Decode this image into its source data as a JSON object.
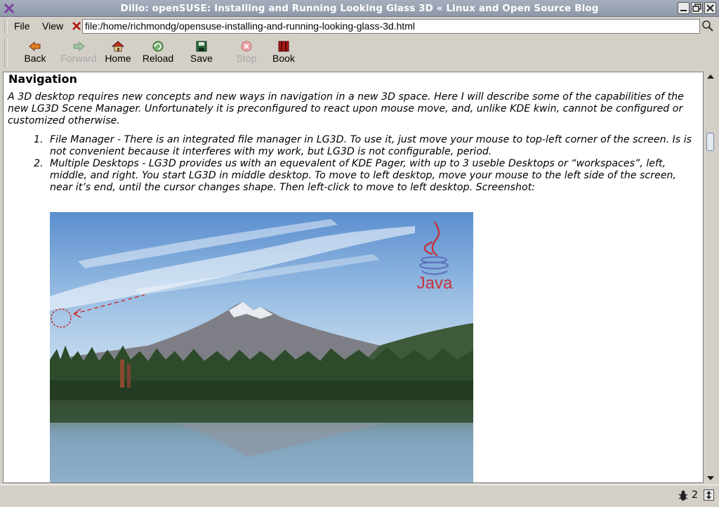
{
  "window": {
    "title": "Dillo: openSUSE: Installing and Running Looking Glass 3D « Linux and Open Source Blog"
  },
  "menu": {
    "file_label": "File",
    "view_label": "View"
  },
  "location": {
    "url": "file:/home/richmondg/opensuse-installing-and-running-looking-glass-3d.html"
  },
  "toolbar": {
    "back_label": "Back",
    "forward_label": "Forward",
    "home_label": "Home",
    "reload_label": "Reload",
    "save_label": "Save",
    "stop_label": "Stop",
    "book_label": "Book"
  },
  "content": {
    "heading": "Navigation",
    "intro": "A 3D desktop requires new concepts and new ways in navigation in a new 3D space. Here I will describe some of the capabilities of the new LG3D Scene Manager. Unfortunately it is preconfigured to react upon mouse move, and, unlike KDE kwin, cannot be configured or customized otherwise.",
    "list": [
      {
        "number": "1.",
        "text": "File Manager - There is an integrated file manager in LG3D. To use it, just move your mouse to top-left corner of the screen. Is is not convenient because it interferes with my work, but LG3D is not configurable, period."
      },
      {
        "number": "2.",
        "text": "Multiple Desktops - LG3D provides us with an equevalent of KDE Pager, with up to 3 useble Desktops or “workspaces”, left, middle, and right. You start LG3D in middle desktop. To move to left desktop, move your mouse to the left side of the screen, near it’s end, until the cursor changes shape. Then left-click to move to left desktop. Screenshot:"
      }
    ],
    "screenshot_logo_text": "Java"
  },
  "statusbar": {
    "bug_count": "2"
  },
  "colors": {
    "titlebar": "#98a1b1",
    "chrome": "#d4d0c8",
    "java_red": "#c8323a",
    "java_blue": "#5a6fb8"
  }
}
